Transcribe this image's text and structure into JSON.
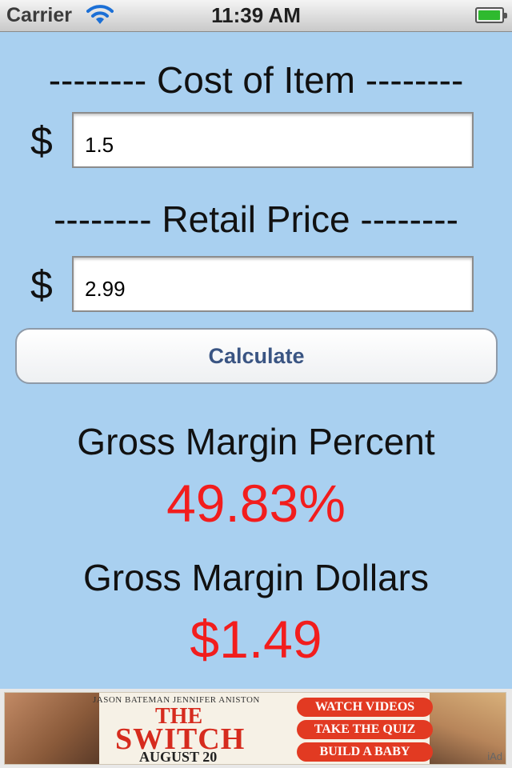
{
  "status_bar": {
    "carrier": "Carrier",
    "time": "11:39 AM",
    "battery_level": 0.95,
    "icons": [
      "wifi-icon",
      "battery-icon"
    ]
  },
  "cost_section": {
    "heading": "-------- Cost of Item --------",
    "currency": "$",
    "value": "1.5"
  },
  "retail_section": {
    "heading": "-------- Retail Price --------",
    "currency": "$",
    "value": "2.99"
  },
  "calculate_button": {
    "label": "Calculate"
  },
  "results": {
    "percent_label": "Gross Margin Percent",
    "percent_value": "49.83%",
    "dollars_label": "Gross Margin Dollars",
    "dollars_value": "$1.49"
  },
  "ad_banner": {
    "actors": "JASON BATEMAN    JENNIFER ANISTON",
    "title_line1": "THE",
    "title_line2": "SWITCH",
    "date": "AUGUST 20",
    "buttons": [
      "WATCH VIDEOS",
      "TAKE THE QUIZ",
      "BUILD A BABY"
    ],
    "network": "iAd"
  },
  "colors": {
    "background": "#a9d0f0",
    "result_value": "#f21d1d",
    "button_text": "#3a5583",
    "ad_button": "#e23a22"
  }
}
